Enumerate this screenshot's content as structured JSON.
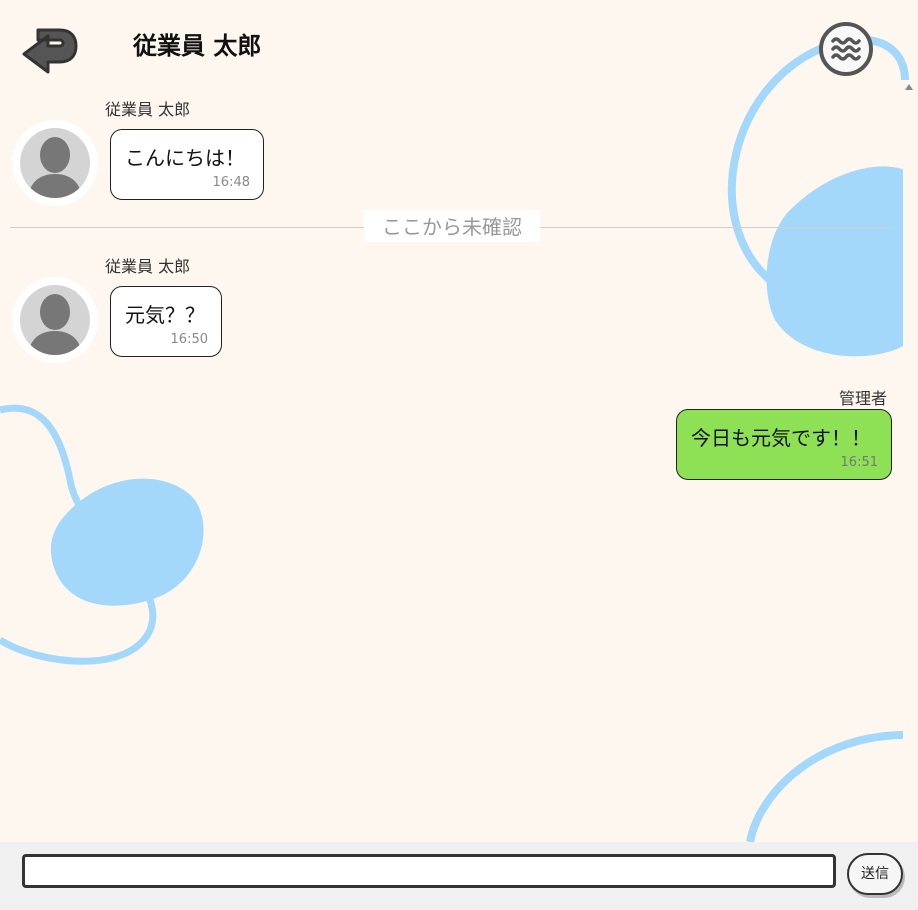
{
  "header": {
    "title": "従業員 太郎",
    "back_icon": "back-arrow-icon",
    "menu_icon": "wave-menu-icon"
  },
  "messages": [
    {
      "sender": "従業員 太郎",
      "text": "こんにちは！",
      "time": "16:48",
      "side": "left"
    },
    {
      "sender": "従業員 太郎",
      "text": "元気？？",
      "time": "16:50",
      "side": "left"
    },
    {
      "sender": "管理者",
      "text": "今日も元気です！！",
      "time": "16:51",
      "side": "right"
    }
  ],
  "divider": {
    "label": "ここから未確認"
  },
  "composer": {
    "input_value": "",
    "send_label": "送信"
  },
  "colors": {
    "background": "#fef7f0",
    "my_bubble": "#8ee055",
    "decoration": "#a3d8fb"
  }
}
